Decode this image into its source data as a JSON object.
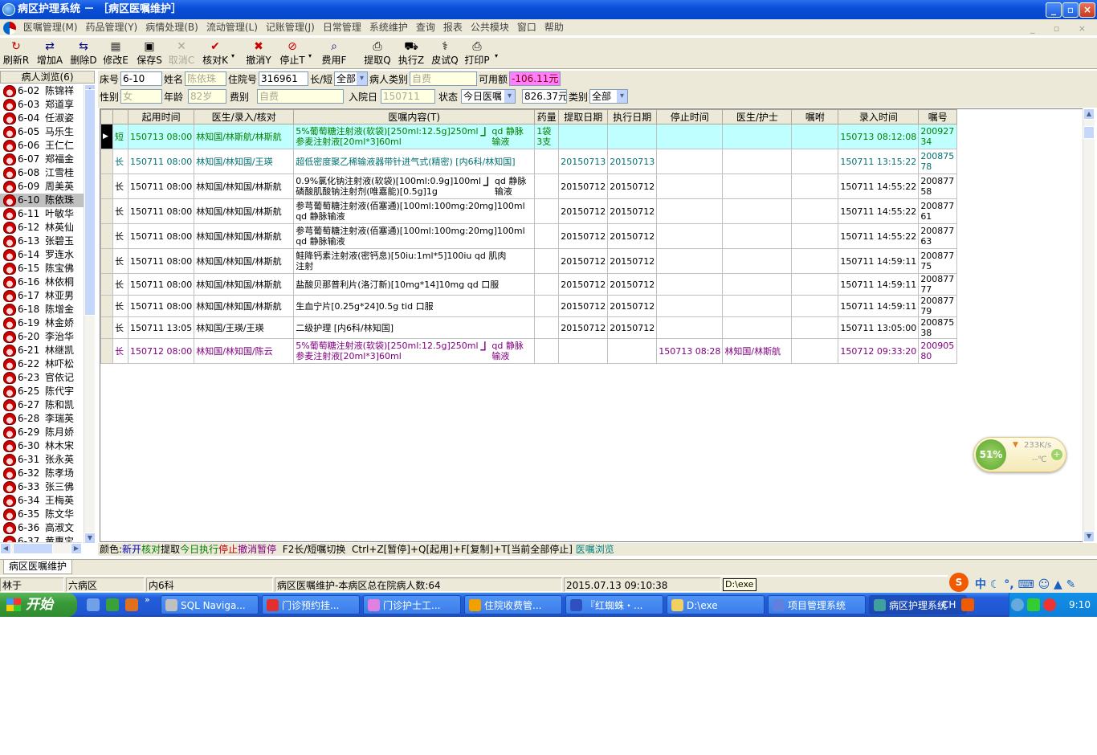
{
  "window": {
    "title": "病区护理系统  － ［病区医嘱维护］",
    "controls": [
      "_",
      "▫",
      "×"
    ]
  },
  "menu": [
    "医嘱管理(M)",
    "药品管理(Y)",
    "病情处理(B)",
    "流动管理(L)",
    "记账管理(J)",
    "日常管理",
    "系统维护",
    "查询",
    "报表",
    "公共模块",
    "窗口",
    "帮助"
  ],
  "mdi_controls": "_ ▫ ×",
  "toolbar": [
    {
      "label": "刷新R",
      "icon": "refresh-icon",
      "glyph": "↻",
      "color": "#c00000",
      "enabled": true
    },
    {
      "label": "增加A",
      "icon": "add-icon",
      "glyph": "⇄",
      "color": "#000080",
      "enabled": true
    },
    {
      "label": "删除D",
      "icon": "delete-icon",
      "glyph": "⇆",
      "color": "#000080",
      "enabled": true
    },
    {
      "label": "修改E",
      "icon": "edit-icon",
      "glyph": "▦",
      "color": "#404040",
      "enabled": true
    },
    {
      "label": "保存S",
      "icon": "save-icon",
      "glyph": "▣",
      "color": "#000000",
      "enabled": true
    },
    {
      "label": "取消C",
      "icon": "cancel-icon",
      "glyph": "✕",
      "color": "#aca899",
      "enabled": false
    },
    {
      "label": "核对K",
      "icon": "check-icon",
      "glyph": "✔",
      "color": "#cc0000",
      "enabled": true
    },
    {
      "label": "撤消Y",
      "icon": "revoke-icon",
      "glyph": "✖",
      "color": "#cc0000",
      "enabled": true
    },
    {
      "label": "停止T",
      "icon": "stop-icon",
      "glyph": "⊘",
      "color": "#cc0000",
      "enabled": true
    },
    {
      "label": "费用F",
      "icon": "fee-icon",
      "glyph": "⌕",
      "color": "#000080",
      "enabled": true
    },
    {
      "label": "提取Q",
      "icon": "extract-icon",
      "glyph": "⎙",
      "color": "#000000",
      "enabled": true
    },
    {
      "label": "执行Z",
      "icon": "execute-icon",
      "glyph": "⛟",
      "color": "#000000",
      "enabled": true
    },
    {
      "label": "皮试Q",
      "icon": "skin-test-icon",
      "glyph": "⚕",
      "color": "#000000",
      "enabled": true
    },
    {
      "label": "打印P",
      "icon": "print-icon",
      "glyph": "⎙",
      "color": "#000000",
      "enabled": true
    }
  ],
  "patient_panel": {
    "header": "病人浏览(6)",
    "patients": [
      {
        "bed": "6-02",
        "name": "陈锦祥"
      },
      {
        "bed": "6-03",
        "name": "郑道享"
      },
      {
        "bed": "6-04",
        "name": "任淑姿"
      },
      {
        "bed": "6-05",
        "name": "马乐生"
      },
      {
        "bed": "6-06",
        "name": "王仁仁"
      },
      {
        "bed": "6-07",
        "name": "郑福金"
      },
      {
        "bed": "6-08",
        "name": "江雪桂"
      },
      {
        "bed": "6-09",
        "name": "周美英"
      },
      {
        "bed": "6-10",
        "name": "陈依珠",
        "selected": true
      },
      {
        "bed": "6-11",
        "name": "叶敏华"
      },
      {
        "bed": "6-12",
        "name": "林英仙"
      },
      {
        "bed": "6-13",
        "name": "张碧玉"
      },
      {
        "bed": "6-14",
        "name": "罗连水"
      },
      {
        "bed": "6-15",
        "name": "陈宝佛"
      },
      {
        "bed": "6-16",
        "name": "林依桐"
      },
      {
        "bed": "6-17",
        "name": "林亚男"
      },
      {
        "bed": "6-18",
        "name": "陈增金"
      },
      {
        "bed": "6-19",
        "name": "林金娇"
      },
      {
        "bed": "6-20",
        "name": "李治华"
      },
      {
        "bed": "6-21",
        "name": "林继凯"
      },
      {
        "bed": "6-22",
        "name": "林吓松"
      },
      {
        "bed": "6-23",
        "name": "官依记"
      },
      {
        "bed": "6-25",
        "name": "陈代宇"
      },
      {
        "bed": "6-27",
        "name": "陈和凯"
      },
      {
        "bed": "6-28",
        "name": "李瑞英"
      },
      {
        "bed": "6-29",
        "name": "陈月娇"
      },
      {
        "bed": "6-30",
        "name": "林木宋"
      },
      {
        "bed": "6-31",
        "name": "张永英"
      },
      {
        "bed": "6-32",
        "name": "陈孝场"
      },
      {
        "bed": "6-33",
        "name": "张三佛"
      },
      {
        "bed": "6-34",
        "name": "王梅英"
      },
      {
        "bed": "6-35",
        "name": "陈文华"
      },
      {
        "bed": "6-36",
        "name": "高淑文"
      },
      {
        "bed": "6-37",
        "name": "黄惠宝"
      }
    ]
  },
  "form": {
    "bed_label": "床号",
    "bed": "6-10",
    "name_label": "姓名",
    "name": "陈依珠",
    "inpatient_no_label": "住院号",
    "inpatient_no": "316961",
    "long_short_label": "长/短",
    "long_short": "全部",
    "patient_type_label": "病人类别",
    "patient_type": "自费",
    "available_label": "可用额",
    "available": "-106.11元",
    "sex_label": "性别",
    "sex": "女",
    "age_label": "年龄",
    "age": "82岁",
    "fee_type_label": "费别",
    "fee_type": "自费",
    "admit_date_label": "入院日",
    "admit_date": "150711",
    "status_label": "状态",
    "status": "今日医嘱",
    "amount": "826.37元",
    "category_label": "类别",
    "category": "全部"
  },
  "grid": {
    "columns": [
      "",
      "",
      "起用时间",
      "医生/录入/核对",
      "医嘱内容(T)",
      "药量",
      "提取日期",
      "执行日期",
      "停止时间",
      "医生/护士",
      "嘱咐",
      "录入时间",
      "嘱号"
    ],
    "rows": [
      {
        "current": true,
        "color": "g",
        "type": "短",
        "start": "150713 08:00",
        "doctor": "林知国/林斯航/林斯航",
        "content": [
          "5%葡萄糖注射液(软袋)[250ml:12.5g]250ml",
          "参麦注射液[20ml*3]60ml"
        ],
        "route": [
          "qd 静脉",
          "输液"
        ],
        "bracket": true,
        "dose": [
          "1袋",
          "3支"
        ],
        "extract": "",
        "execute": "",
        "stop": "",
        "nurse": "",
        "note": "",
        "entry": "150713 08:12:08",
        "no": "20092734"
      },
      {
        "color": "t",
        "type": "长",
        "start": "150711 08:00",
        "doctor": "林知国/林知国/王瑛",
        "content": [
          "超低密度聚乙稀输液器带针进气式(精密)   [内6科/林知国]"
        ],
        "route": [],
        "bracket": false,
        "dose": [],
        "extract": "20150713",
        "execute": "20150713",
        "stop": "",
        "nurse": "",
        "note": "",
        "entry": "150711 13:15:22",
        "no": "20087578"
      },
      {
        "color": "b",
        "type": "长",
        "start": "150711 08:00",
        "doctor": "林知国/林知国/林斯航",
        "content": [
          "0.9%氯化钠注射液(软袋)[100ml:0.9g]100ml",
          "磷酸肌酸钠注射剂(唯嘉能)[0.5g]1g"
        ],
        "route": [
          "qd 静脉",
          "输液"
        ],
        "bracket": true,
        "dose": [],
        "extract": "20150712",
        "execute": "20150712",
        "stop": "",
        "nurse": "",
        "note": "",
        "entry": "150711 14:55:22",
        "no": "20087758"
      },
      {
        "color": "b",
        "type": "长",
        "start": "150711 08:00",
        "doctor": "林知国/林知国/林斯航",
        "content": [
          "参芎葡萄糖注射液(佰塞通)[100ml:100mg:20mg]100ml",
          " qd 静脉输液"
        ],
        "route": [],
        "bracket": false,
        "dose": [],
        "extract": "20150712",
        "execute": "20150712",
        "stop": "",
        "nurse": "",
        "note": "",
        "entry": "150711 14:55:22",
        "no": "20087761"
      },
      {
        "color": "b",
        "type": "长",
        "start": "150711 08:00",
        "doctor": "林知国/林知国/林斯航",
        "content": [
          "参芎葡萄糖注射液(佰塞通)[100ml:100mg:20mg]100ml",
          " qd 静脉输液"
        ],
        "route": [],
        "bracket": false,
        "dose": [],
        "extract": "20150712",
        "execute": "20150712",
        "stop": "",
        "nurse": "",
        "note": "",
        "entry": "150711 14:55:22",
        "no": "20087763"
      },
      {
        "color": "b",
        "type": "长",
        "start": "150711 08:00",
        "doctor": "林知国/林知国/林斯航",
        "content": [
          "鲑降钙素注射液(密钙息)[50iu:1ml*5]100iu qd 肌肉",
          "注射"
        ],
        "route": [],
        "bracket": false,
        "dose": [],
        "extract": "20150712",
        "execute": "20150712",
        "stop": "",
        "nurse": "",
        "note": "",
        "entry": "150711 14:59:11",
        "no": "20087775"
      },
      {
        "short": true,
        "color": "b",
        "type": "长",
        "start": "150711 08:00",
        "doctor": "林知国/林知国/林斯航",
        "content": [
          "盐酸贝那普利片(洛汀新)[10mg*14]10mg qd 口服"
        ],
        "route": [],
        "bracket": false,
        "dose": [],
        "extract": "20150712",
        "execute": "20150712",
        "stop": "",
        "nurse": "",
        "note": "",
        "entry": "150711 14:59:11",
        "no": "20087777"
      },
      {
        "short": true,
        "color": "b",
        "type": "长",
        "start": "150711 08:00",
        "doctor": "林知国/林知国/林斯航",
        "content": [
          "生血宁片[0.25g*24]0.5g tid 口服"
        ],
        "route": [],
        "bracket": false,
        "dose": [],
        "extract": "20150712",
        "execute": "20150712",
        "stop": "",
        "nurse": "",
        "note": "",
        "entry": "150711 14:59:11",
        "no": "20087779"
      },
      {
        "short": true,
        "color": "b",
        "type": "长",
        "start": "150711 13:05",
        "doctor": "林知国/王瑛/王瑛",
        "content": [
          "二级护理   [内6科/林知国]"
        ],
        "route": [],
        "bracket": false,
        "dose": [],
        "extract": "20150712",
        "execute": "20150712",
        "stop": "",
        "nurse": "",
        "note": "",
        "entry": "150711 13:05:00",
        "no": "20087538"
      },
      {
        "color": "p",
        "type": "长",
        "start": "150712 08:00",
        "doctor": "林知国/林知国/陈云",
        "content": [
          "5%葡萄糖注射液(软袋)[250ml:12.5g]250ml",
          "参麦注射液[20ml*3]60ml"
        ],
        "route": [
          "qd 静脉",
          "输液"
        ],
        "bracket": true,
        "dose": [],
        "extract": "",
        "execute": "",
        "stop": "150713 08:28",
        "nurse": "林知国/林斯航",
        "note": "",
        "entry": "150712 09:33:20",
        "no": "20090580"
      }
    ]
  },
  "legend": [
    {
      "text": "颜色:",
      "color": "#000000"
    },
    {
      "text": "新开",
      "color": "#0000c0"
    },
    {
      "text": "核对",
      "color": "#008000"
    },
    {
      "text": "提取",
      "color": "#000000"
    },
    {
      "text": "今日执行",
      "color": "#008000"
    },
    {
      "text": "停止",
      "color": "#c00000"
    },
    {
      "text": "撤消",
      "color": "#800080"
    },
    {
      "text": "暂停",
      "color": "#800080"
    },
    {
      "text": "  F2长/短嘱切换  Ctrl+Z[暂停]+Q[起用]+F[复制]+T[当前全部停止] ",
      "color": "#000000"
    },
    {
      "text": "医嘱浏览",
      "color": "#008080"
    }
  ],
  "tab": "病区医嘱维护",
  "status": {
    "user": "林于",
    "ward": "六病区",
    "dept": "内6科",
    "message": "病区医嘱维护-本病区总在院病人数:64",
    "datetime": "2015.07.13 09:10:38",
    "path": "D:\\exe"
  },
  "widget": {
    "percent": "51%",
    "speed": "233K/s",
    "temp": "--℃"
  },
  "taskbar": {
    "start": "开始",
    "tasks": [
      {
        "label": "SQL Naviga...",
        "icon": "sql-navigator-icon",
        "color": "#c0c0c0"
      },
      {
        "label": "门诊预约挂...",
        "icon": "appointment-icon",
        "color": "#e03030"
      },
      {
        "label": "门诊护士工...",
        "icon": "nurse-station-icon",
        "color": "#e080e0"
      },
      {
        "label": "住院收费管...",
        "icon": "billing-icon",
        "color": "#f0a000"
      },
      {
        "label": "『红蜘蛛・...",
        "icon": "red-spider-icon",
        "color": "#3050c0"
      },
      {
        "label": "D:\\exe",
        "icon": "folder-icon",
        "color": "#f0d060"
      },
      {
        "label": "项目管理系统",
        "icon": "project-icon",
        "color": "#6080e0"
      },
      {
        "label": "病区护理系统",
        "icon": "ward-nursing-icon",
        "color": "#40a0a0",
        "active": true
      }
    ],
    "tray_lang": "CH",
    "clock": "9:10"
  }
}
